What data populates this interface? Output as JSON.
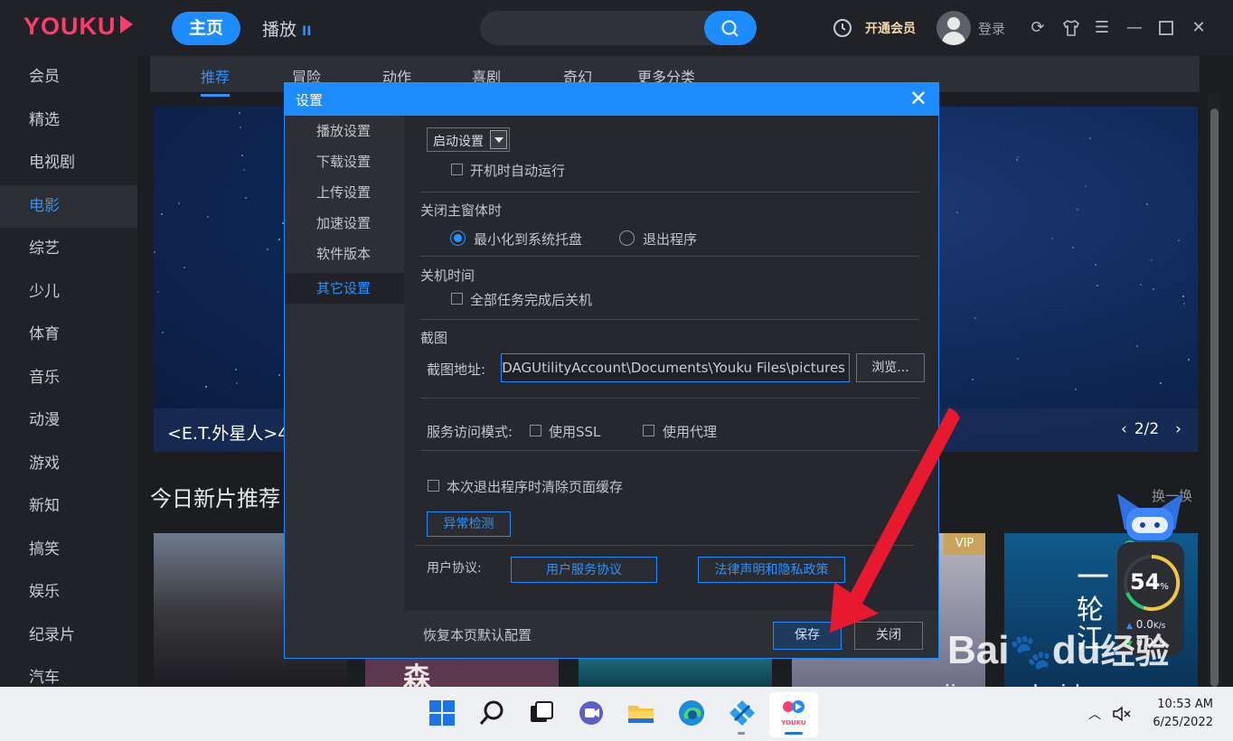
{
  "app": {
    "logo": "YOUKU",
    "nav_home": "主页",
    "nav_play": "播放",
    "nav_play_icon": "pause-icon",
    "search_placeholder": "",
    "vip_label": "开通会员",
    "login_label": "登录"
  },
  "sidebar": {
    "items": [
      {
        "label": "会员"
      },
      {
        "label": "精选"
      },
      {
        "label": "电视剧"
      },
      {
        "label": "电影",
        "active": true
      },
      {
        "label": "综艺"
      },
      {
        "label": "少儿"
      },
      {
        "label": "体育"
      },
      {
        "label": "音乐"
      },
      {
        "label": "动漫"
      },
      {
        "label": "游戏"
      },
      {
        "label": "新知"
      },
      {
        "label": "搞笑"
      },
      {
        "label": "娱乐"
      },
      {
        "label": "纪录片"
      },
      {
        "label": "汽车"
      }
    ]
  },
  "categories": {
    "items": [
      {
        "label": "推荐",
        "active": true
      },
      {
        "label": "冒险"
      },
      {
        "label": "动作"
      },
      {
        "label": "喜剧"
      },
      {
        "label": "奇幻"
      },
      {
        "label": "更多分类"
      }
    ]
  },
  "banner": {
    "title": "<E.T.外星人>4",
    "pager": "2/2"
  },
  "section": {
    "title": "今日新片推荐",
    "change": "换一换",
    "vip_badge": "VIP",
    "poster_text_1": "森",
    "poster_text_2": "一",
    "poster_text_3": "轮",
    "poster_text_4": "江"
  },
  "dialog": {
    "title": "设置",
    "nav": [
      {
        "label": "播放设置"
      },
      {
        "label": "下载设置"
      },
      {
        "label": "上传设置"
      },
      {
        "label": "加速设置"
      },
      {
        "label": "软件版本"
      },
      {
        "label": "其它设置",
        "active": true
      }
    ],
    "startup_select": "启动设置",
    "autostart_label": "开机时自动运行",
    "close_main_heading": "关闭主窗体时",
    "minimize_label": "最小化到系统托盘",
    "exit_label": "退出程序",
    "shutdown_heading": "关机时间",
    "shutdown_label": "全部任务完成后关机",
    "screenshot_heading": "截图",
    "screenshot_path_label": "截图地址:",
    "screenshot_path": "C:\\Users\\WDAGUtilityAccount\\Documents\\Youku Files\\pictures",
    "browse_label": "浏览...",
    "service_mode_label": "服务访问模式:",
    "ssl_label": "使用SSL",
    "proxy_label": "使用代理",
    "clear_cache_label": "本次退出程序时清除页面缓存",
    "diagnose_label": "异常检测",
    "agreement_label": "用户协议:",
    "user_agreement": "用户服务协议",
    "legal_privacy": "法律声明和隐私政策",
    "restore_default": "恢复本页默认配置",
    "save_label": "保存",
    "close_label": "关闭"
  },
  "widget": {
    "percent": "54",
    "percent_unit": "%",
    "up_speed": "0.0",
    "down_speed": "0.0",
    "speed_unit": "K/s"
  },
  "watermark": {
    "brand": "Bai",
    "brand2": "du",
    "cn": "经验",
    "url": "jingyan.baidu.com"
  },
  "taskbar": {
    "time": "10:53 AM",
    "date": "6/25/2022",
    "youku_label": "YOUKU"
  },
  "colors": {
    "accent": "#1d8cff",
    "brand": "#ff3d6c",
    "arrow": "#e8182e"
  }
}
